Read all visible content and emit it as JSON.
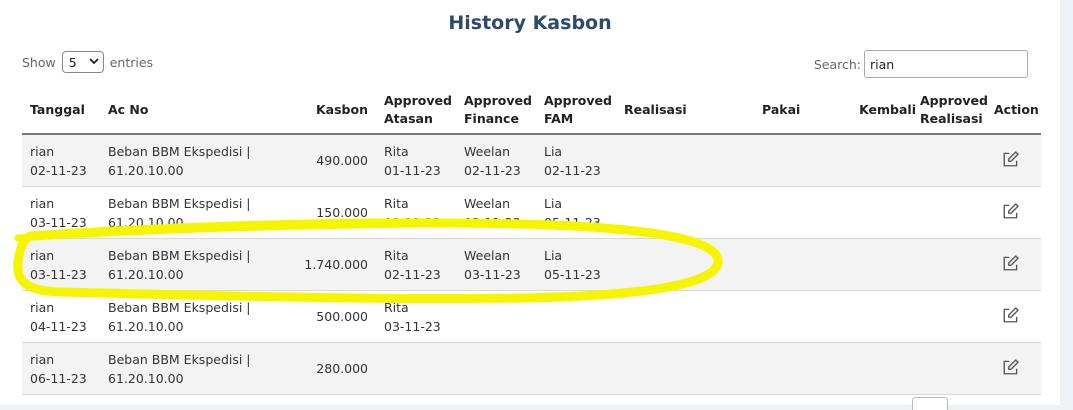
{
  "title": "History Kasbon",
  "length": {
    "show_label": "Show",
    "value": "5",
    "entries_label": "entries"
  },
  "search": {
    "label": "Search:",
    "value": "rian"
  },
  "columns": {
    "tanggal": "Tanggal",
    "acno": "Ac No",
    "kasbon": "Kasbon",
    "approved_atasan_1": "Approved",
    "approved_atasan_2": "Atasan",
    "approved_finance_1": "Approved",
    "approved_finance_2": "Finance",
    "approved_fam_1": "Approved",
    "approved_fam_2": "FAM",
    "realisasi": "Realisasi",
    "pakai": "Pakai",
    "kembali": "Kembali",
    "approved_realisasi_1": "Approved",
    "approved_realisasi_2": "Realisasi",
    "action": "Action"
  },
  "rows": [
    {
      "name": "rian",
      "date": "02-11-23",
      "ac1": "Beban BBM Ekspedisi |",
      "ac2": "61.20.10.00",
      "kasbon": "490.000",
      "atasan_name": "Rita",
      "atasan_date": "01-11-23",
      "fin_name": "Weelan",
      "fin_date": "02-11-23",
      "fam_name": "Lia",
      "fam_date": "02-11-23"
    },
    {
      "name": "rian",
      "date": "03-11-23",
      "ac1": "Beban BBM Ekspedisi |",
      "ac2": "61.20.10.00",
      "kasbon": "150.000",
      "atasan_name": "Rita",
      "atasan_date": "03-11-23",
      "fin_name": "Weelan",
      "fin_date": "03-11-23",
      "fam_name": "Lia",
      "fam_date": "05-11-23"
    },
    {
      "name": "rian",
      "date": "03-11-23",
      "ac1": "Beban BBM Ekspedisi |",
      "ac2": "61.20.10.00",
      "kasbon": "1.740.000",
      "atasan_name": "Rita",
      "atasan_date": "02-11-23",
      "fin_name": "Weelan",
      "fin_date": "03-11-23",
      "fam_name": "Lia",
      "fam_date": "05-11-23"
    },
    {
      "name": "rian",
      "date": "04-11-23",
      "ac1": "Beban BBM Ekspedisi |",
      "ac2": "61.20.10.00",
      "kasbon": "500.000",
      "atasan_name": "Rita",
      "atasan_date": "03-11-23",
      "fin_name": "",
      "fin_date": "",
      "fam_name": "",
      "fam_date": ""
    },
    {
      "name": "rian",
      "date": "06-11-23",
      "ac1": "Beban BBM Ekspedisi |",
      "ac2": "61.20.10.00",
      "kasbon": "280.000",
      "atasan_name": "",
      "atasan_date": "",
      "fin_name": "",
      "fin_date": "",
      "fam_name": "",
      "fam_date": ""
    }
  ],
  "icons": {
    "edit": "edit-icon",
    "select_caret": "chevron-down-icon"
  },
  "colors": {
    "title": "#2d4a6c",
    "highlight": "#f5f500",
    "row_stripe": "#f3f3f3"
  }
}
